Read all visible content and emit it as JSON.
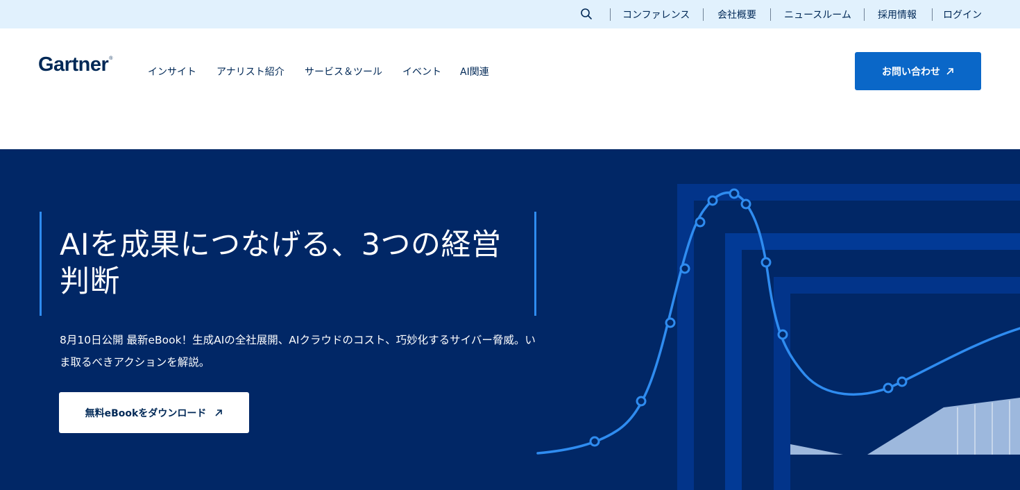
{
  "utility_nav": {
    "search_icon": "search-icon",
    "links": [
      "コンファレンス",
      "会社概要",
      "ニュースルーム",
      "採用情報",
      "ログイン"
    ]
  },
  "header": {
    "logo": "Gartner",
    "logo_mark": "®",
    "nav": [
      "インサイト",
      "アナリスト紹介",
      "サービス＆ツール",
      "イベント",
      "AI関連"
    ],
    "cta_label": "お問い合わせ",
    "cta_icon": "arrow-up-right-icon"
  },
  "hero": {
    "title": "AIを成果につなげる、3つの経営判断",
    "description": "8月10日公開 最新eBook！生成AIの全社展開、AIクラウドのコスト、巧妙化するサイバー脅威。いま取るべきアクションを解説。",
    "button_label": "無料eBookをダウンロード",
    "button_icon": "arrow-up-right-icon"
  },
  "colors": {
    "utility_bg": "#e1f1fd",
    "brand_navy": "#002856",
    "hero_bg": "#012766",
    "accent_blue": "#0a67c8",
    "curve_blue": "#2f8cf0"
  }
}
